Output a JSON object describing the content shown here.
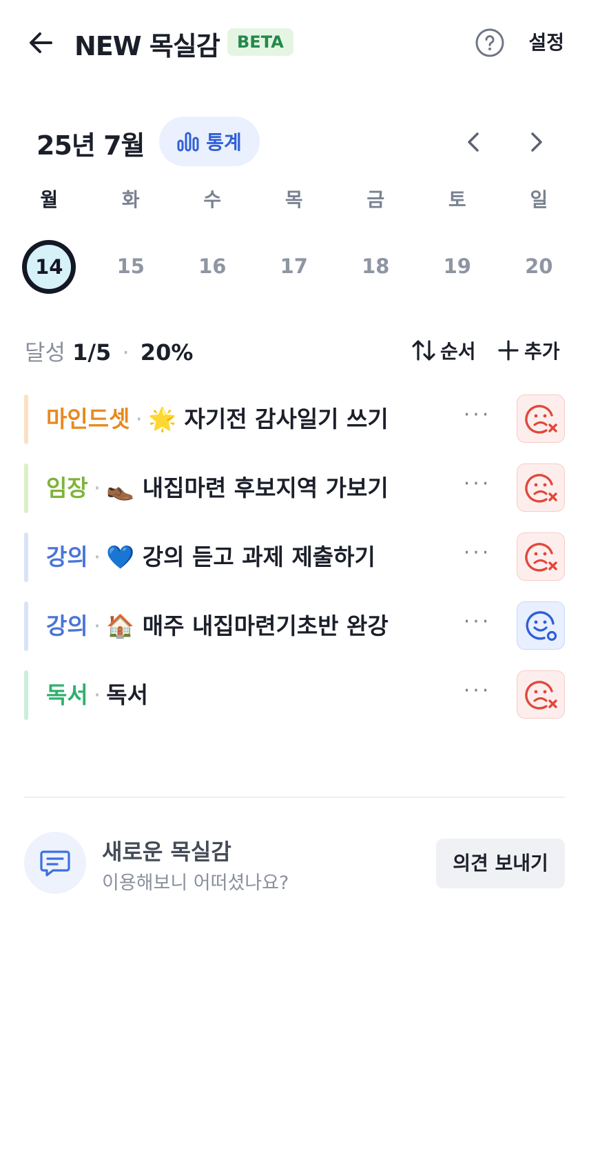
{
  "header": {
    "back_icon": "arrow-left-icon",
    "title": "NEW 목실감",
    "badge": "BETA",
    "help_icon": "question-circle-icon",
    "settings_label": "설정"
  },
  "calendar": {
    "month_label": "25년 7월",
    "stats_label": "통계",
    "stats_icon": "bar-chart-icon",
    "weekdays": [
      "월",
      "화",
      "수",
      "목",
      "금",
      "토",
      "일"
    ],
    "dates": [
      "14",
      "15",
      "16",
      "17",
      "18",
      "19",
      "20"
    ],
    "selected_index": 0
  },
  "progress": {
    "label": "달성",
    "count": "1/5",
    "separator": "·",
    "percent": "20%",
    "order_label": "순서",
    "add_label": "추가"
  },
  "tasks": [
    {
      "category": "마인드셋",
      "title": "🌟 자기전 감사일기 쓰기",
      "color": "#e8891f",
      "bar_color": "#fbe1c3",
      "status": "fail"
    },
    {
      "category": "임장",
      "title": "👞 내집마련 후보지역 가보기",
      "color": "#7fb33a",
      "bar_color": "#dbf0c4",
      "status": "fail"
    },
    {
      "category": "강의",
      "title": "💙 강의 듣고 과제 제출하기",
      "color": "#4a74d8",
      "bar_color": "#d9e3f8",
      "status": "fail"
    },
    {
      "category": "강의",
      "title": "🏠 매주 내집마련기초반 완강",
      "color": "#4a74d8",
      "bar_color": "#d9e3f8",
      "status": "success"
    },
    {
      "category": "독서",
      "title": "독서",
      "color": "#2fb06d",
      "bar_color": "#c9efd9",
      "status": "fail"
    }
  ],
  "task_more": "···",
  "feedback": {
    "icon": "chat-bubble-icon",
    "title": "새로운 목실감",
    "subtitle": "이용해보니 어떠셨나요?",
    "button_label": "의견 보내기"
  }
}
